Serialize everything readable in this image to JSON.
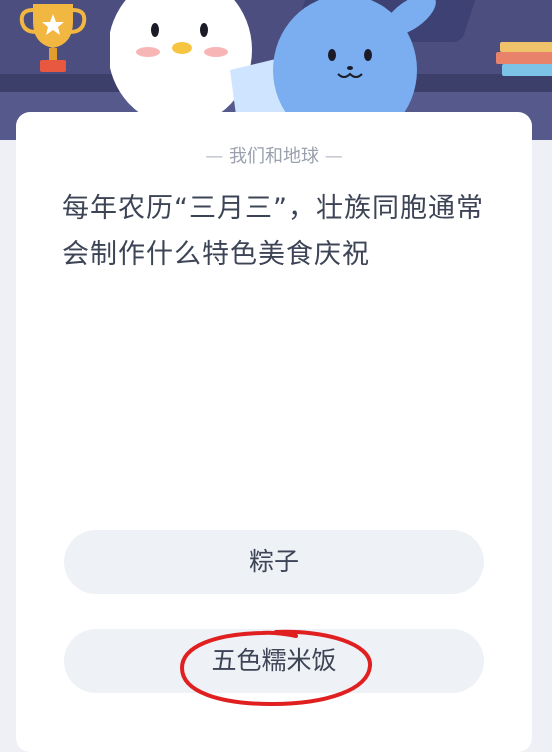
{
  "header": {
    "banner_description_icons": [
      "trophy-icon",
      "books-icon",
      "mascot-characters"
    ]
  },
  "card": {
    "section_title": "我们和地球",
    "question": "每年农历“三月三”，壮族同胞通常会制作什么特色美食庆祝",
    "options": [
      {
        "label": "粽子"
      },
      {
        "label": "五色糯米饭"
      }
    ]
  },
  "colors": {
    "banner": "#4b4e7e",
    "card": "#ffffff",
    "option_bg": "#eef1f5",
    "text": "#3d4456",
    "annotation": "#e02020"
  }
}
